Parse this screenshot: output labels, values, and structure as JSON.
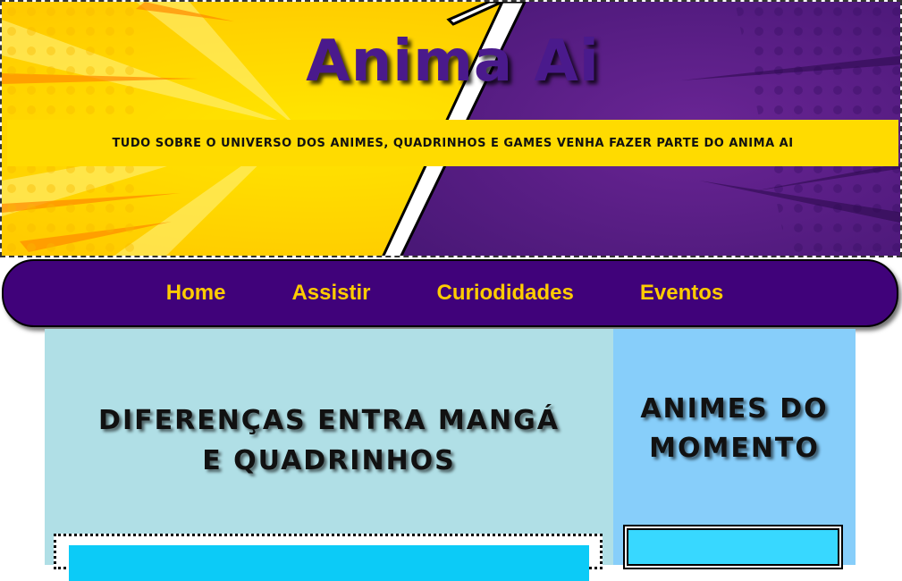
{
  "header": {
    "title": "Anima Ai",
    "tagline": "TUDO SOBRE O UNIVERSO DOS ANIMES, QUADRINHOS E GAMES VENHA FAZER PARTE DO ANIMA AI"
  },
  "nav": {
    "items": [
      {
        "label": "Home"
      },
      {
        "label": "Assistir"
      },
      {
        "label": "Curiodidades"
      },
      {
        "label": "Eventos"
      }
    ]
  },
  "main": {
    "heading": "DIFERENÇAS ENTRA MANGÁ E QUADRINHOS"
  },
  "aside": {
    "heading": "ANIMES DO MOMENTO"
  },
  "colors": {
    "yellow": "#ffdb00",
    "purple": "#4a1a8c",
    "nav_bg": "#40027a",
    "nav_text": "#ffcc00",
    "main_bg": "#b0dfe6",
    "aside_bg": "#87cefa",
    "card_fill": "#0ccbf7"
  }
}
